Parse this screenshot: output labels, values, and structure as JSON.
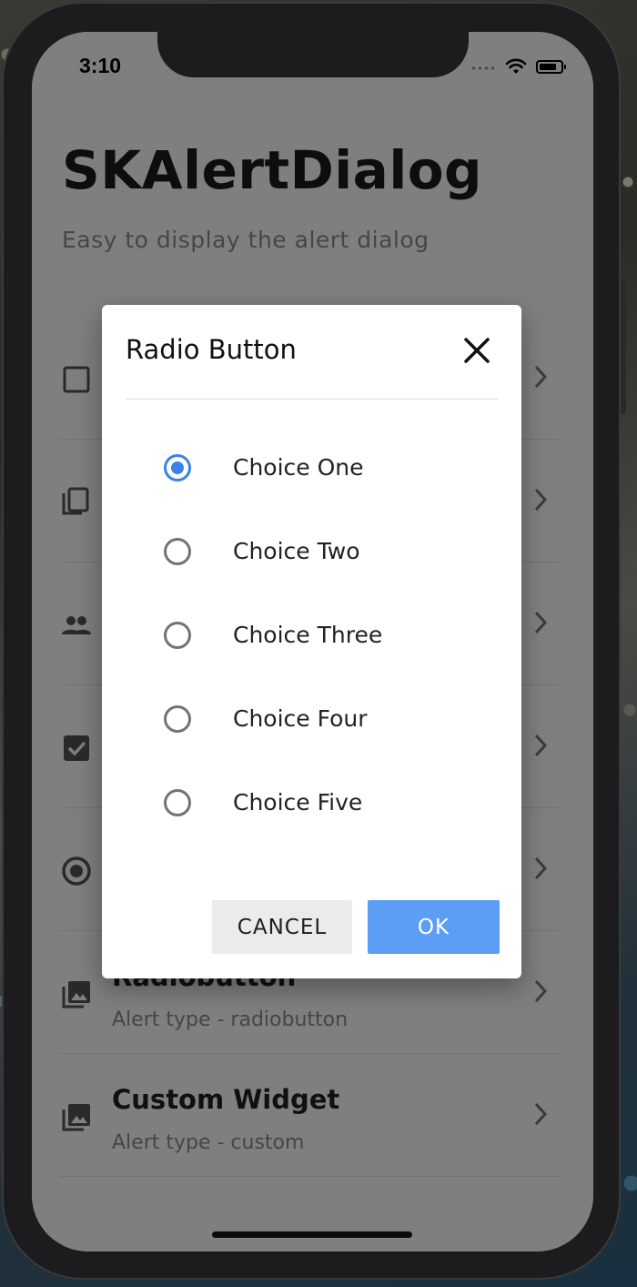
{
  "status_bar": {
    "time": "3:10"
  },
  "app": {
    "title": "SKAlertDialog",
    "subtitle": "Easy to display the alert dialog"
  },
  "list": [
    {
      "icon": "checkbox-outline-icon",
      "title": "",
      "subtitle": ""
    },
    {
      "icon": "copy-icon",
      "title": "",
      "subtitle": ""
    },
    {
      "icon": "people-icon",
      "title": "",
      "subtitle": ""
    },
    {
      "icon": "checkbox-checked-icon",
      "title": "",
      "subtitle": ""
    },
    {
      "icon": "radio-button-icon",
      "title": "",
      "subtitle": ""
    },
    {
      "icon": "image-icon",
      "title": "Radiobutton",
      "subtitle": "Alert type - radiobutton"
    },
    {
      "icon": "image-icon",
      "title": "Custom Widget",
      "subtitle": "Alert type - custom"
    }
  ],
  "dialog": {
    "title": "Radio Button",
    "options": [
      {
        "label": "Choice One",
        "selected": true
      },
      {
        "label": "Choice Two",
        "selected": false
      },
      {
        "label": "Choice Three",
        "selected": false
      },
      {
        "label": "Choice Four",
        "selected": false
      },
      {
        "label": "Choice Five",
        "selected": false
      }
    ],
    "cancel_label": "CANCEL",
    "ok_label": "OK"
  },
  "colors": {
    "accent": "#3b82e6",
    "ok_button": "#5c9df5",
    "cancel_button": "#ebebed"
  }
}
